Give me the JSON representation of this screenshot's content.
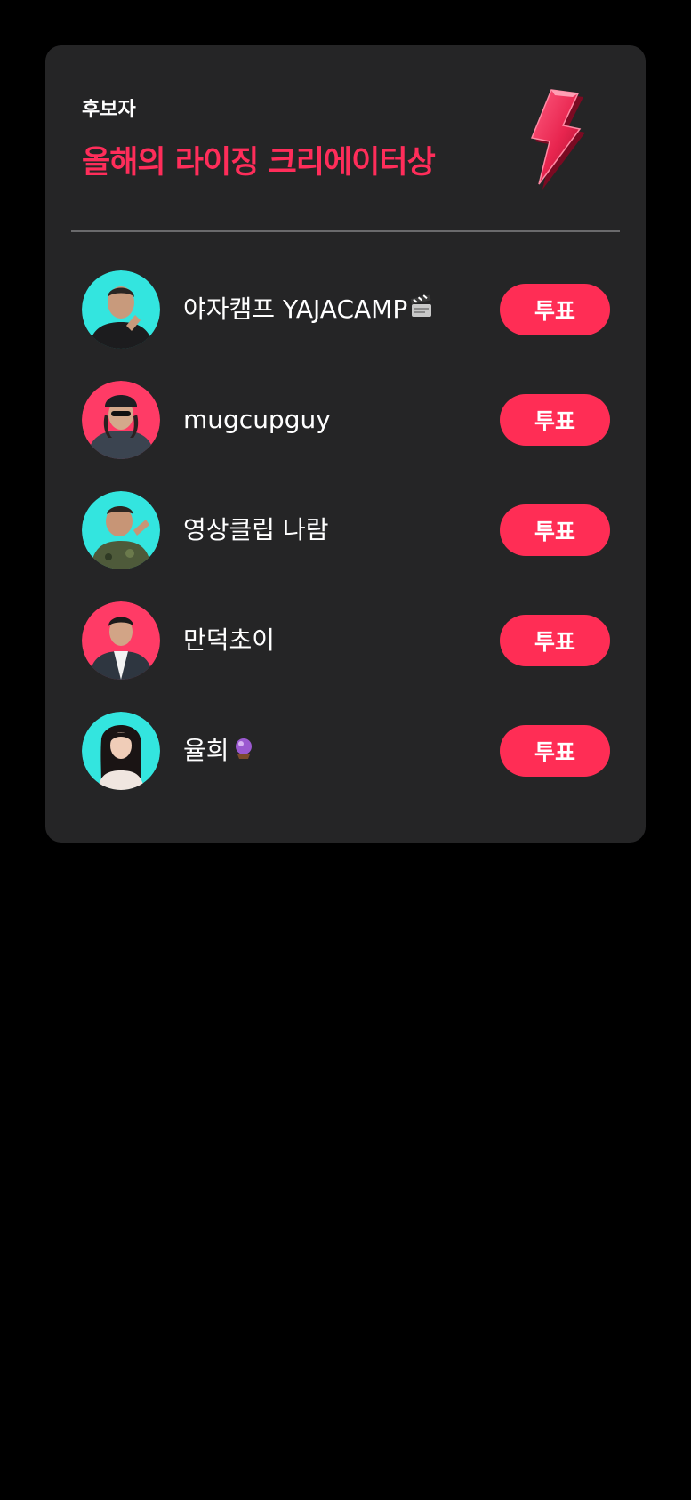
{
  "card": {
    "eyebrow": "후보자",
    "title": "올해의 라이징 크리에이터상",
    "accent_color": "#ff2d55",
    "bolt_icon": "lightning-bolt-icon"
  },
  "nominees": [
    {
      "name": "야자캠프 YAJACAMP",
      "emoji_icon": "clapper-board-icon",
      "avatar_bg": "#2ee6e0",
      "vote_label": "투표"
    },
    {
      "name": "mugcupguy",
      "emoji_icon": "",
      "avatar_bg": "#ff3b66",
      "vote_label": "투표"
    },
    {
      "name": "영상클립 나람",
      "emoji_icon": "",
      "avatar_bg": "#2ee6e0",
      "vote_label": "투표"
    },
    {
      "name": "만덕초이",
      "emoji_icon": "",
      "avatar_bg": "#ff3b66",
      "vote_label": "투표"
    },
    {
      "name": "율희",
      "emoji_icon": "crystal-ball-icon",
      "avatar_bg": "#2ee6e0",
      "vote_label": "투표"
    }
  ]
}
